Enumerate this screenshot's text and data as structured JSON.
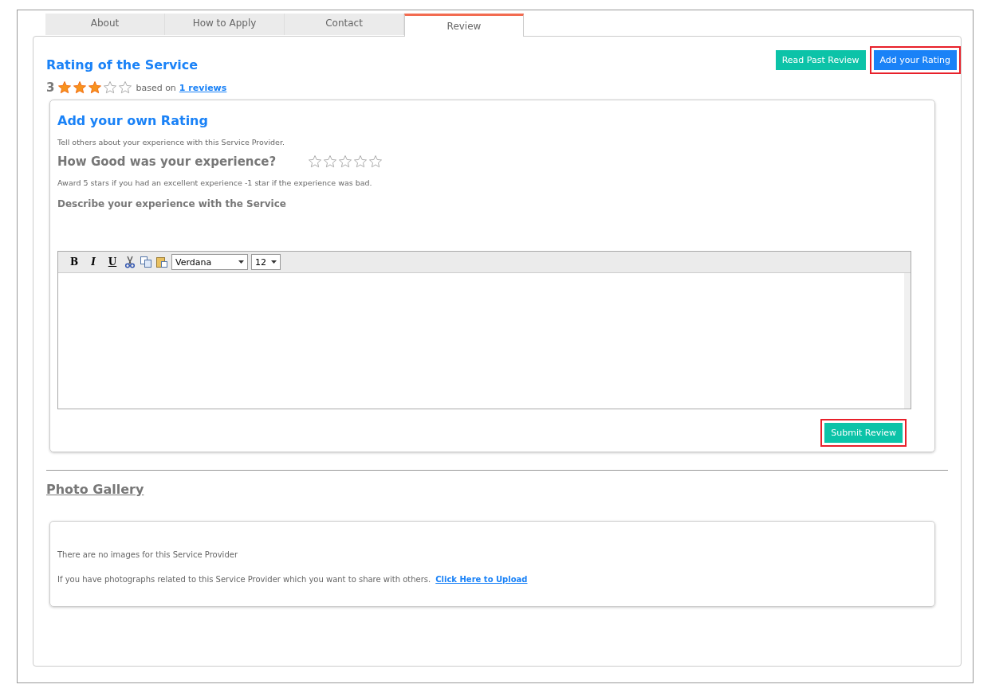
{
  "tabs": [
    {
      "label": "About",
      "selected": false
    },
    {
      "label": "How to Apply",
      "selected": false
    },
    {
      "label": "Contact",
      "selected": false
    },
    {
      "label": "Review",
      "selected": true
    }
  ],
  "rating": {
    "title": "Rating of the Service",
    "score": "3",
    "stars": 3,
    "based_on": "based on",
    "reviews_link": "1 reviews"
  },
  "actions": [
    {
      "label": "Read Past Review",
      "kind": "secondary",
      "highlighted": false
    },
    {
      "label": "Add your Rating",
      "kind": "primary",
      "highlighted": true
    }
  ],
  "own_rating": {
    "title": "Add your own Rating",
    "intro": "Tell others about your experience with this Service Provider.",
    "question": "How Good was your experience?",
    "stars": 0,
    "hint": "Award 5 stars if you had an excellent experience -1 star if the experience was bad.",
    "describe_label": "Describe your experience with the Service",
    "editor": {
      "bold": "B",
      "italic": "I",
      "underline": "U",
      "font": "Verdana",
      "size": "12"
    },
    "submit": {
      "label": "Submit Review",
      "highlighted": true
    }
  },
  "gallery": {
    "title": "Photo Gallery",
    "empty_text": "There are no images for this Service Provider",
    "share_text": "If you have photographs related to this Service Provider which you want to share with others.",
    "upload_link": "Click Here to Upload"
  }
}
